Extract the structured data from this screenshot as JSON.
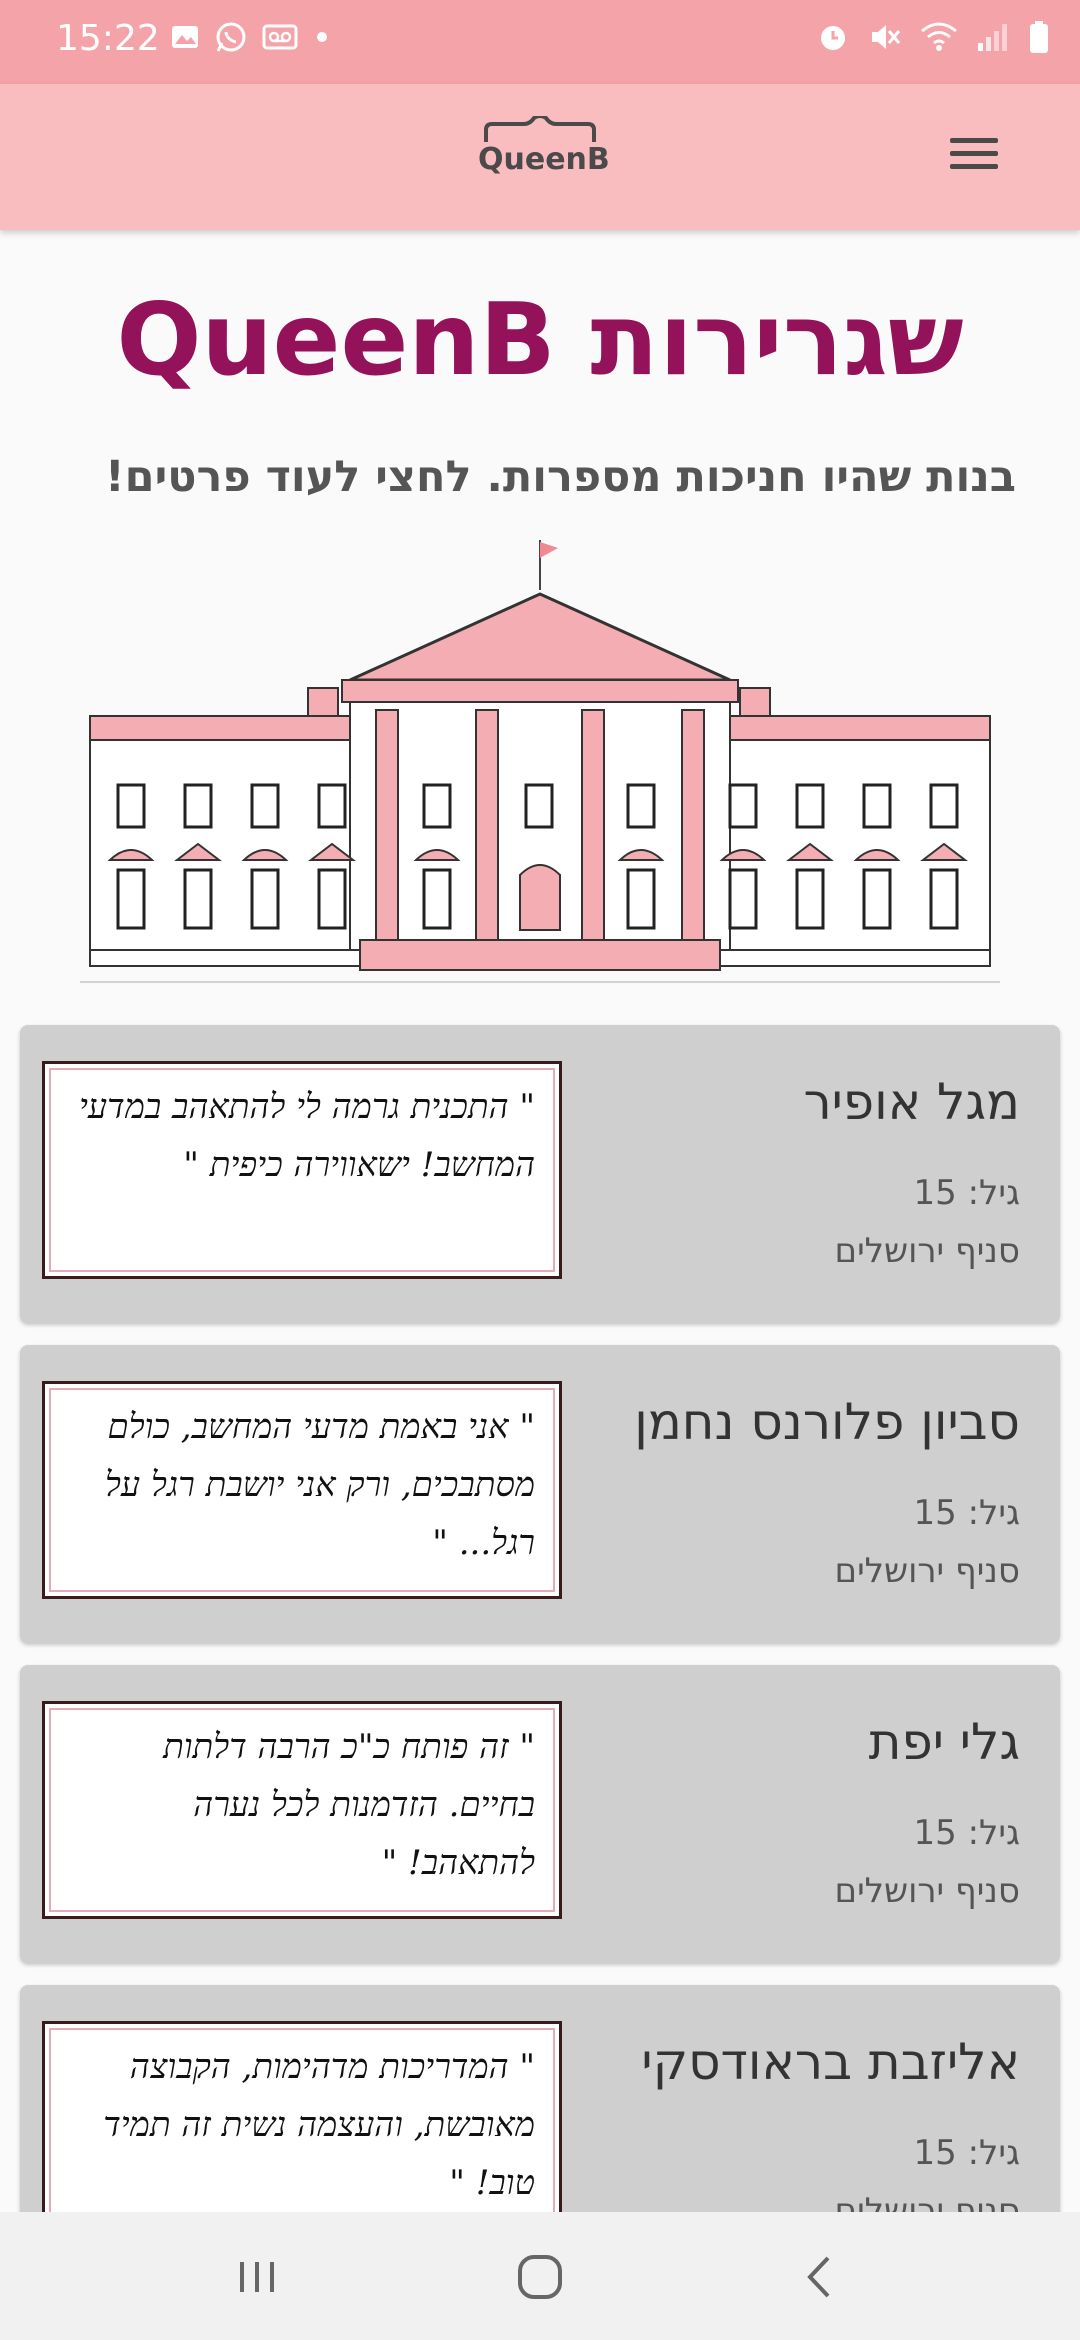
{
  "status_bar": {
    "time": "15:22",
    "left_icons": [
      "gallery-icon",
      "whatsapp-icon",
      "voicemail-icon",
      "dot-icon"
    ],
    "right_icons": [
      "alarm-icon",
      "mute-icon",
      "wifi-icon",
      "signal-icon",
      "battery-icon"
    ]
  },
  "app_bar": {
    "logo_text": "QueenB",
    "menu_icon": "hamburger-menu-icon"
  },
  "page": {
    "title": "שגרירות QueenB",
    "subtitle": "בנות שהיו חניכות מספרות. לחצי לעוד פרטים!"
  },
  "ambassadors": [
    {
      "name": "מגל אופיר",
      "age": "גיל: 15",
      "branch": "סניף ירושלים",
      "quote": "\" התכנית גרמה לי להתאהב במדעי המחשב! ישאווירה כיפית \""
    },
    {
      "name": "סביון פלורנס נחמן",
      "age": "גיל: 15",
      "branch": "סניף ירושלים",
      "quote": "\" אני באמת מדעי המחשב, כולם מסתבכים, ורק אני יושבת רגל על רגל... \""
    },
    {
      "name": "גלי יפת",
      "age": "גיל: 15",
      "branch": "סניף ירושלים",
      "quote": "\" זה פותח כ\"כ הרבה דלתות בחיים. הזדמנות לכל נערה להתאהב! \""
    },
    {
      "name": "אליזבת בראודסקי",
      "age": "גיל: 15",
      "branch": "סניף ירושלים",
      "quote": "\" המדריכות מדהימות, הקבוצה מאובשת, והעצמה נשית זה תמיד טוב! \""
    }
  ],
  "nav_bar": {
    "icons": [
      "recent-apps-icon",
      "home-icon",
      "back-icon"
    ]
  },
  "colors": {
    "status_bar": "#f4a3a8",
    "app_bar": "#f9bcbf",
    "title": "#94125a",
    "card": "#cfcfcf"
  }
}
